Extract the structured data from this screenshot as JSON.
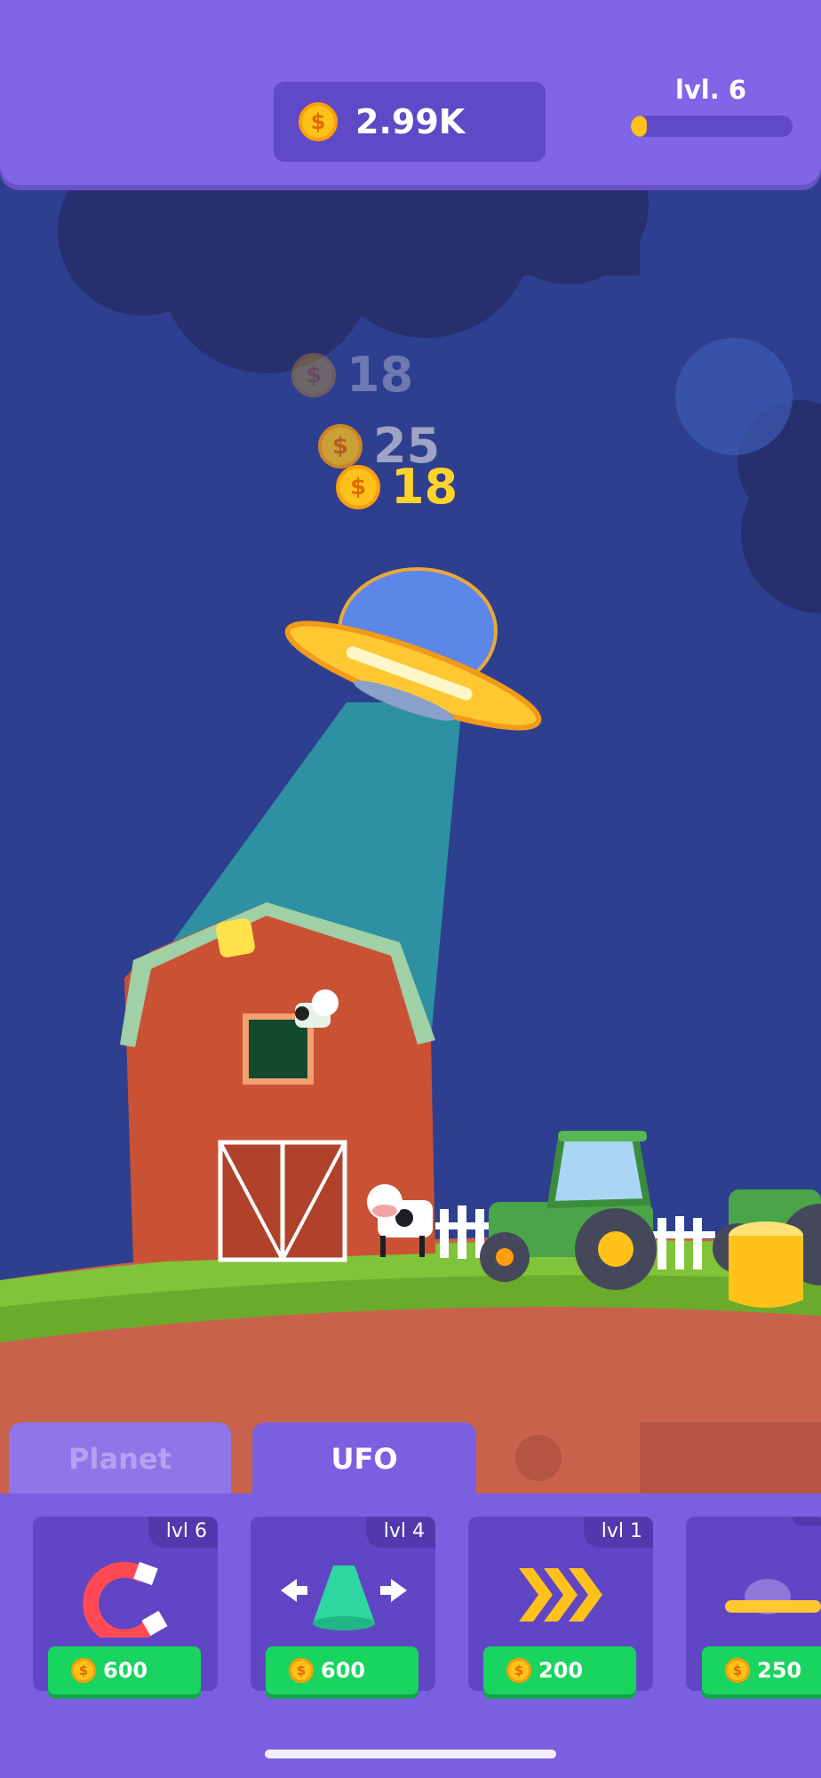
{
  "hud": {
    "coins": "2.99K",
    "level_label": "lvl. 6",
    "level_progress": 0.1
  },
  "floating_rewards": [
    {
      "value": "18",
      "faded": true
    },
    {
      "value": "25",
      "faded": false
    },
    {
      "value": "18",
      "faded": false
    }
  ],
  "coin_symbol": "$",
  "tabs": [
    {
      "label": "Planet",
      "active": false
    },
    {
      "label": "UFO",
      "active": true
    }
  ],
  "upgrades": [
    {
      "icon": "magnet-icon",
      "level": "lvl 6",
      "price": "600"
    },
    {
      "icon": "beam-width-icon",
      "level": "lvl 4",
      "price": "600"
    },
    {
      "icon": "speed-arrows-icon",
      "level": "lvl 1",
      "price": "200"
    },
    {
      "icon": "ufo-icon",
      "level": "",
      "price": "250"
    }
  ],
  "colors": {
    "primary_purple": "#7f66e6",
    "coin_gold": "#ffc21a",
    "buy_green": "#19d45e",
    "sky": "#2e3f8f"
  }
}
